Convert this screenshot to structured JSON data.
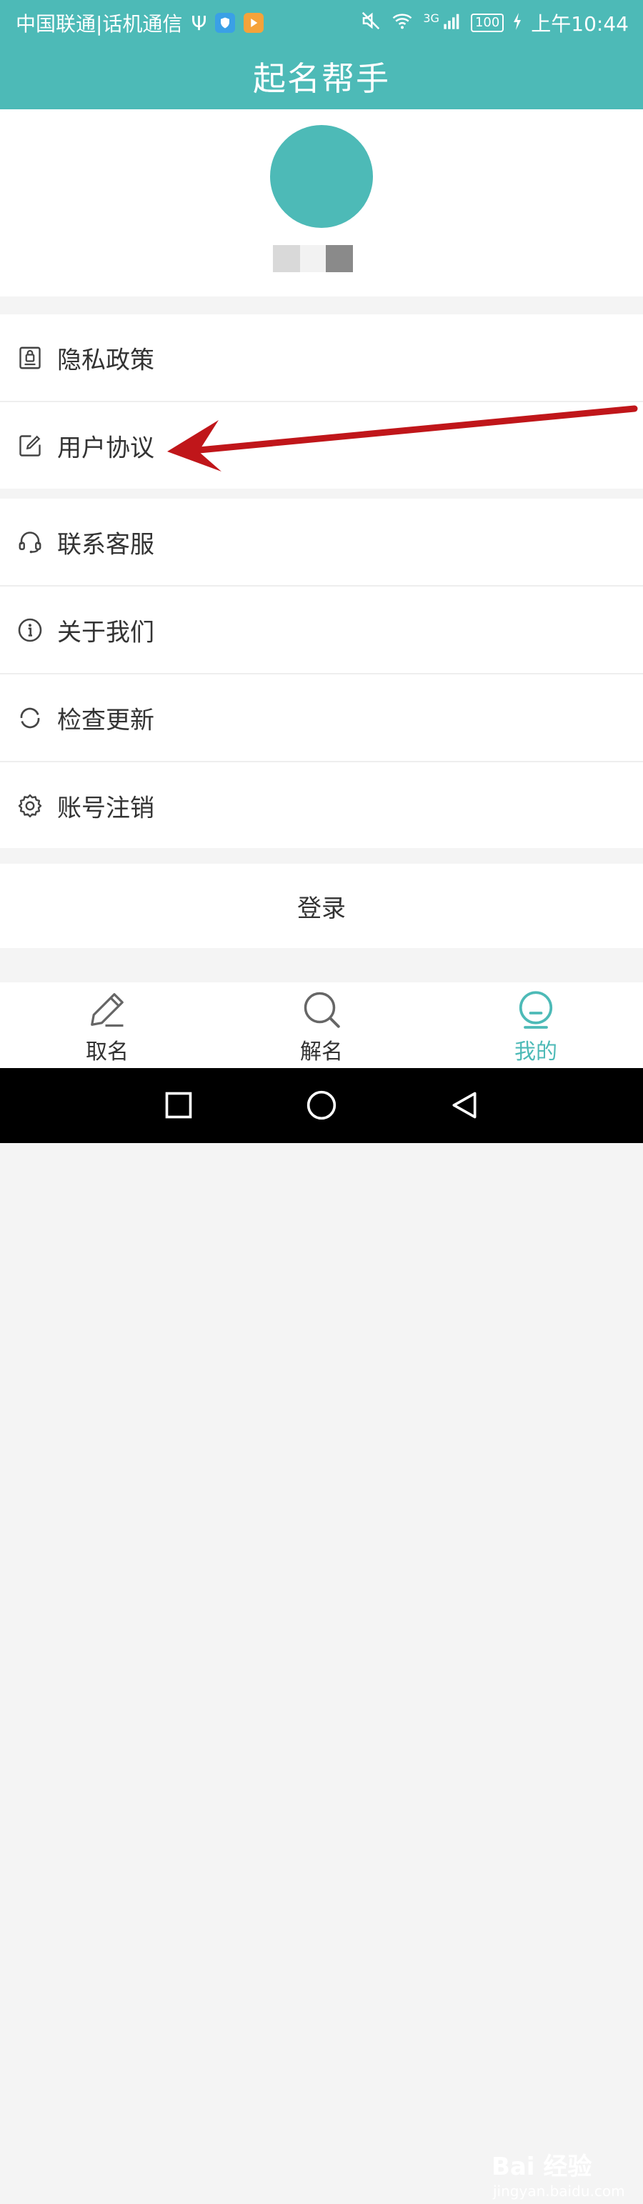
{
  "status_bar": {
    "carrier": "中国联通|话机通信",
    "usb_symbol": "Ψ",
    "network": "3G",
    "battery": "100",
    "time": "上午10:44"
  },
  "header": {
    "title": "起名帮手"
  },
  "profile": {
    "name_placeholder": ""
  },
  "menu": {
    "group1": [
      {
        "label": "隐私政策",
        "icon": "privacy-icon"
      },
      {
        "label": "用户协议",
        "icon": "edit-document-icon"
      }
    ],
    "group2": [
      {
        "label": "联系客服",
        "icon": "headset-icon"
      },
      {
        "label": "关于我们",
        "icon": "info-icon"
      },
      {
        "label": "检查更新",
        "icon": "refresh-icon"
      },
      {
        "label": "账号注销",
        "icon": "gear-icon"
      }
    ]
  },
  "login": {
    "label": "登录"
  },
  "bottom_nav": {
    "items": [
      {
        "label": "取名",
        "icon": "pencil-icon",
        "active": false
      },
      {
        "label": "解名",
        "icon": "search-icon",
        "active": false
      },
      {
        "label": "我的",
        "icon": "profile-icon",
        "active": true
      }
    ]
  },
  "watermark": {
    "main": "Bai 经验",
    "sub": "jingyan.baidu.com"
  },
  "colors": {
    "accent": "#4dbab7",
    "arrow": "#c0161a"
  }
}
